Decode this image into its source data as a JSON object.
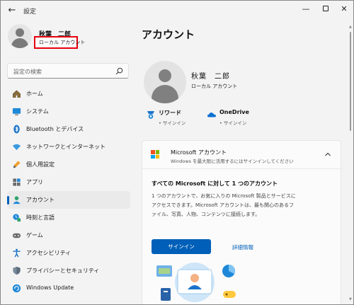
{
  "window": {
    "title": "設定",
    "back_glyph": "←",
    "min_glyph": "—",
    "close_glyph": "✕"
  },
  "sidebar": {
    "user_name": "秋葉　二郎",
    "account_type": "ローカル アカウント",
    "search_placeholder": "設定の検索",
    "items": [
      {
        "label": "ホーム",
        "icon": "home-icon"
      },
      {
        "label": "システム",
        "icon": "system-icon"
      },
      {
        "label": "Bluetooth とデバイス",
        "icon": "bluetooth-icon"
      },
      {
        "label": "ネットワークとインターネット",
        "icon": "network-icon"
      },
      {
        "label": "個人用設定",
        "icon": "personalization-icon"
      },
      {
        "label": "アプリ",
        "icon": "apps-icon"
      },
      {
        "label": "アカウント",
        "icon": "accounts-icon",
        "active": true
      },
      {
        "label": "時刻と言語",
        "icon": "time-language-icon"
      },
      {
        "label": "ゲーム",
        "icon": "gaming-icon"
      },
      {
        "label": "アクセシビリティ",
        "icon": "accessibility-icon"
      },
      {
        "label": "プライバシーとセキュリティ",
        "icon": "privacy-icon"
      },
      {
        "label": "Windows Update",
        "icon": "windows-update-icon"
      }
    ]
  },
  "main": {
    "page_title": "アカウント",
    "account_name": "秋葉　二郎",
    "account_type": "ローカル アカウント",
    "services": [
      {
        "name": "リワード",
        "status": "• サインイン",
        "icon": "rewards-icon"
      },
      {
        "name": "OneDrive",
        "status": "• サインイン",
        "icon": "onedrive-icon"
      }
    ],
    "ms_card": {
      "title": "Microsoft アカウント",
      "subtitle": "Windows を最大限に活用するにはサインインしてください",
      "heading": "すべての Microsoft に対して 1 つのアカウント",
      "description": "1 つのアカウントで、お気に入りの Microsoft 製品とサービスにアクセスできます。Microsoft アカウントは、最も関心のあるファイル、写真、人物、コンテンツに接続します。",
      "signin_label": "サインイン",
      "details_label": "詳細情報"
    }
  },
  "colors": {
    "accent": "#005fb8",
    "highlight_box": "#e8000d",
    "ms_red": "#f25022",
    "ms_green": "#7fba00",
    "ms_blue": "#00a4ef",
    "ms_yellow": "#ffb900"
  }
}
